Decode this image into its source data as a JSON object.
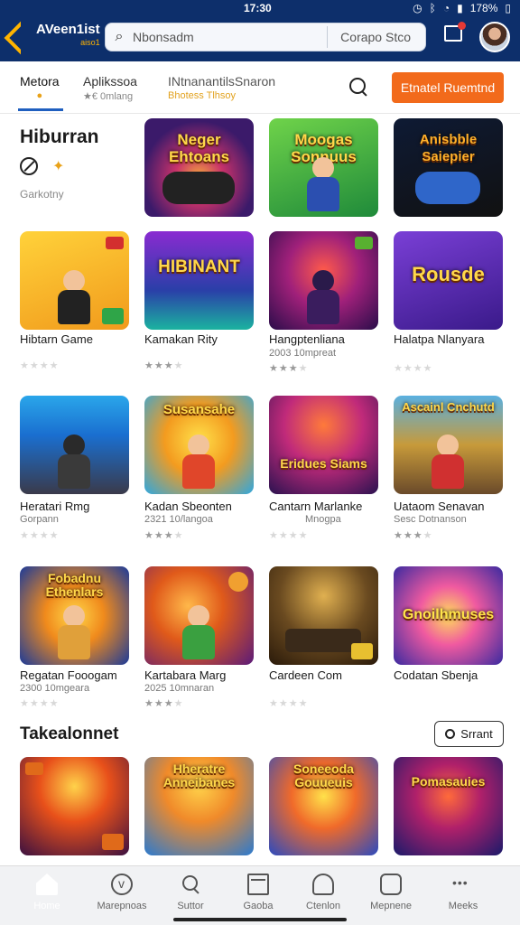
{
  "status": {
    "time": "17:30",
    "battery": "178%"
  },
  "header": {
    "logo_main": "AVeen1ist",
    "logo_sub": "aiso1",
    "search_placeholder": "Nbonsadm",
    "filter_label": "Corapo Stco"
  },
  "tabs": [
    {
      "label": "Metora",
      "sub": "●"
    },
    {
      "label": "Aplikssoa",
      "sub": "★€ 0mlang"
    },
    {
      "label": "INtnanantilsSnaron",
      "sub": "Bhotess Tlhsoy"
    }
  ],
  "cta_label": "Etnatel Ruemtnd",
  "category": {
    "title": "Hiburran",
    "sub": "Garkotny"
  },
  "grid": [
    {
      "art": "Neger Ehtoans",
      "title": "",
      "meta": "",
      "stars": 0
    },
    {
      "art": "Moogas Sonnuus",
      "title": "",
      "meta": "",
      "stars": 0
    },
    {
      "art": "Anisbble Saiepier",
      "title": "",
      "meta": "",
      "stars": 0
    },
    {
      "art": "",
      "title": "Hibtarn Game",
      "meta": "",
      "stars": 0
    },
    {
      "art": "HIBINANT",
      "title": "Kamakan Rity",
      "meta": "",
      "stars": 3
    },
    {
      "art": "",
      "title": "Hangptenliana",
      "meta": "2003  10mpreat",
      "stars": 3
    },
    {
      "art": "Rousde",
      "title": "Halatpa Nlanyara",
      "meta": "",
      "stars": 0
    },
    {
      "art": "",
      "title": "Heratari Rmg",
      "meta": "Gorpann",
      "stars": 0
    },
    {
      "art": "Susansahe",
      "title": "Kadan Sbeonten",
      "meta": "2321  10/langoa",
      "stars": 3
    },
    {
      "art": "Eridues Siams",
      "title": "Cantarn Marlanke",
      "meta": "Mnogpa",
      "stars": 0
    },
    {
      "art": "Ascainl Cnchutd",
      "title": "Uataom Senavan",
      "meta": "Sesc   Dotnanson",
      "stars": 3
    },
    {
      "art": "Fobadnu Ethenlars",
      "title": "Regatan Fooogam",
      "meta": "2300  10mgeara",
      "stars": 0
    },
    {
      "art": "",
      "title": "Kartabara Marg",
      "meta": "2025  10mnaran",
      "stars": 3
    },
    {
      "art": "",
      "title": "Cardeen Com",
      "meta": "",
      "stars": 0
    },
    {
      "art": "Gnoilhmuses",
      "title": "Codatan Sbenja",
      "meta": "",
      "stars": 0
    }
  ],
  "section2": {
    "title": "Takealonnet",
    "button": "Srrant"
  },
  "row2": [
    {
      "art": ""
    },
    {
      "art": "Hheratre Anneibanes"
    },
    {
      "art": "Soneeoda Gouueuis"
    },
    {
      "art": "Pomasauies"
    }
  ],
  "nav": [
    {
      "label": "Home",
      "icon": "home-icon"
    },
    {
      "label": "Marepnoas",
      "icon": "circle-v-icon"
    },
    {
      "label": "Suttor",
      "icon": "search-icon"
    },
    {
      "label": "Gaoba",
      "icon": "box-icon"
    },
    {
      "label": "Ctenlon",
      "icon": "chat-icon"
    },
    {
      "label": "Mepnene",
      "icon": "robot-icon"
    },
    {
      "label": "Meeks",
      "icon": "more-icon"
    }
  ],
  "colors": {
    "header": "#0d2f6b",
    "accent": "#f26a1b",
    "tab_underline": "#1f5fbf"
  }
}
